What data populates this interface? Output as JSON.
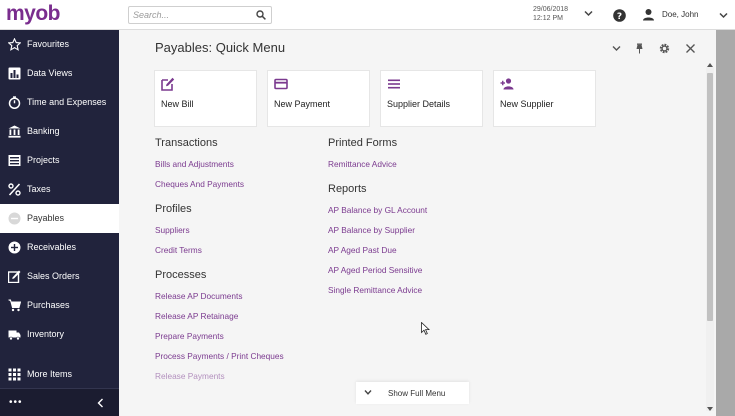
{
  "app": {
    "logo": "myob"
  },
  "search": {
    "placeholder": "Search..."
  },
  "header": {
    "date": "29/06/2018",
    "time": "12:12 PM",
    "user_name": "Doe, John"
  },
  "sidebar": {
    "items": [
      {
        "label": "Favourites",
        "icon": "star-icon"
      },
      {
        "label": "Data Views",
        "icon": "chart-icon"
      },
      {
        "label": "Time and Expenses",
        "icon": "timer-icon"
      },
      {
        "label": "Banking",
        "icon": "bank-icon"
      },
      {
        "label": "Projects",
        "icon": "projects-icon"
      },
      {
        "label": "Taxes",
        "icon": "percent-icon"
      },
      {
        "label": "Payables",
        "icon": "minus-circle-icon",
        "active": true
      },
      {
        "label": "Receivables",
        "icon": "plus-circle-icon"
      },
      {
        "label": "Sales Orders",
        "icon": "edit-icon"
      },
      {
        "label": "Purchases",
        "icon": "cart-icon"
      },
      {
        "label": "Inventory",
        "icon": "truck-icon"
      },
      {
        "label": "More Items",
        "icon": "grid-icon"
      }
    ],
    "bottom_dots": "•••"
  },
  "panel": {
    "title": "Payables: Quick Menu",
    "tiles": [
      {
        "label": "New Bill",
        "icon": "edit-icon"
      },
      {
        "label": "New Payment",
        "icon": "card-icon"
      },
      {
        "label": "Supplier Details",
        "icon": "list-icon"
      },
      {
        "label": "New Supplier",
        "icon": "add-person-icon"
      }
    ],
    "sections_left": [
      {
        "title": "Transactions",
        "links": [
          "Bills and Adjustments",
          "Cheques And Payments"
        ]
      },
      {
        "title": "Profiles",
        "links": [
          "Suppliers",
          "Credit Terms"
        ]
      },
      {
        "title": "Processes",
        "links": [
          "Release AP Documents",
          "Release AP Retainage",
          "Prepare Payments",
          "Process Payments / Print Cheques",
          "Release Payments"
        ]
      }
    ],
    "sections_right": [
      {
        "title": "Printed Forms",
        "links": [
          "Remittance Advice"
        ]
      },
      {
        "title": "Reports",
        "links": [
          "AP Balance by GL Account",
          "AP Balance by Supplier",
          "AP Aged Past Due",
          "AP Aged Period Sensitive",
          "Single Remittance Advice"
        ]
      }
    ],
    "full_menu_label": "Show Full Menu"
  },
  "colors": {
    "brand": "#7a2d8e",
    "sidebar_bg": "#21233c",
    "link": "#7b3a8f"
  }
}
